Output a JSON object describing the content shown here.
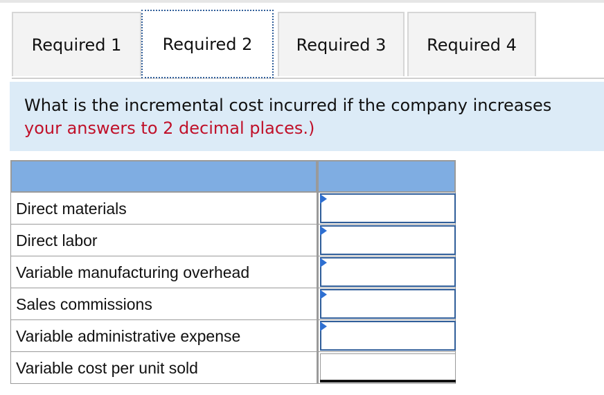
{
  "tabs": [
    {
      "label": "Required 1",
      "active": false
    },
    {
      "label": "Required 2",
      "active": true
    },
    {
      "label": "Required 3",
      "active": false
    },
    {
      "label": "Required 4",
      "active": false
    }
  ],
  "question": {
    "text": "What is the incremental cost incurred if the company increases",
    "instruction": "your answers to 2 decimal places.)"
  },
  "table": {
    "header": {
      "label": "",
      "value": ""
    },
    "rows": [
      {
        "label": "Direct materials",
        "value": ""
      },
      {
        "label": "Direct labor",
        "value": ""
      },
      {
        "label": "Variable manufacturing overhead",
        "value": ""
      },
      {
        "label": "Sales commissions",
        "value": ""
      },
      {
        "label": "Variable administrative expense",
        "value": ""
      }
    ],
    "total": {
      "label": "Variable cost per unit sold",
      "value": ""
    }
  },
  "colors": {
    "question_bg": "#dcebf7",
    "header_bg": "#7fade2",
    "instruction_text": "#c0112a",
    "input_border": "#2f5d99"
  }
}
